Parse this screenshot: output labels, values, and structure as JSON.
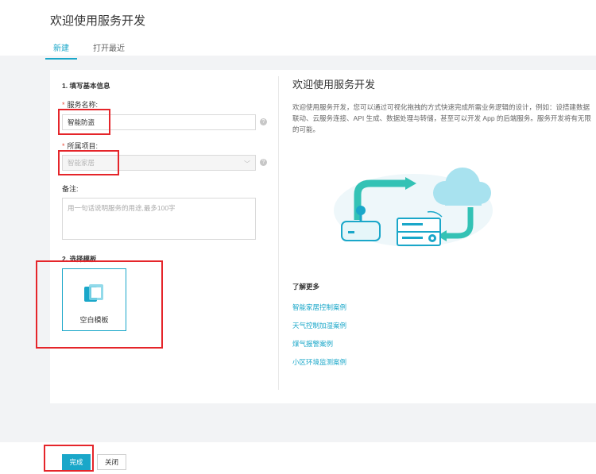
{
  "header": {
    "title": "欢迎使用服务开发",
    "tabs": [
      {
        "label": "新建",
        "active": true
      },
      {
        "label": "打开最近",
        "active": false
      }
    ]
  },
  "form": {
    "section1_title": "1. 填写基本信息",
    "service_name": {
      "label": "服务名称:",
      "value": "智能防盗"
    },
    "project": {
      "label": "所属项目:",
      "value": "智能家居"
    },
    "remark": {
      "label": "备注:",
      "placeholder": "用一句话说明服务的用途,最多100字"
    },
    "section2_title": "2. 选择模板",
    "template_label": "空白模板"
  },
  "intro": {
    "title": "欢迎使用服务开发",
    "description": "欢迎使用服务开发，您可以通过可视化拖拽的方式快速完成所需业务逻辑的设计，例如：设搭建数据联动、云服务连接、API 生成、数据处理与转储，甚至可以开发 App 的后端服务。服务开发将有无限的可能。",
    "learn_more_title": "了解更多",
    "links": [
      "智能家居控制案例",
      "天气控制加湿案例",
      "煤气报警案例",
      "小区环境监测案例"
    ]
  },
  "footer": {
    "done_label": "完成",
    "close_label": "关闭"
  },
  "colors": {
    "accent": "#1aa7c9",
    "highlight": "#e5252a"
  }
}
